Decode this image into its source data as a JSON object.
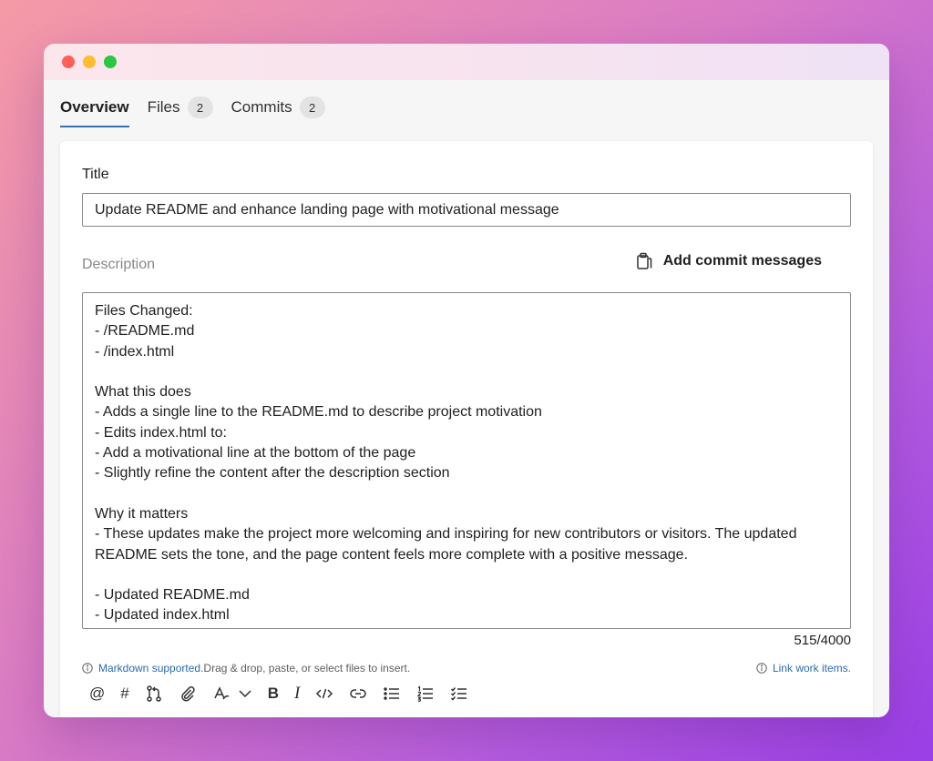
{
  "tabs": [
    {
      "label": "Overview"
    },
    {
      "label": "Files",
      "count": "2"
    },
    {
      "label": "Commits",
      "count": "2"
    }
  ],
  "form": {
    "title_label": "Title",
    "title_value": "Update README and enhance landing page with motivational message",
    "description_label": "Description",
    "add_commit_label": "Add commit messages",
    "description_value": "Files Changed:\n- /README.md\n- /index.html\n\nWhat this does\n- Adds a single line to the README.md to describe project motivation\n- Edits index.html to:\n- Add a motivational line at the bottom of the page\n- Slightly refine the content after the description section\n\nWhy it matters\n- These updates make the project more welcoming and inspiring for new contributors or visitors. The updated README sets the tone, and the page content feels more complete with a positive message.\n\n- Updated README.md\n- Updated index.html",
    "char_count": "515/4000",
    "markdown_link": "Markdown supported.",
    "markdown_hint": " Drag & drop, paste, or select files to insert.",
    "link_work_items": "Link work items."
  },
  "toolbar": {
    "mention": "@",
    "hash": "#",
    "bold": "B",
    "italic": "I"
  },
  "colors": {
    "accent": "#3a6fb0",
    "link": "#2b6cb0"
  }
}
